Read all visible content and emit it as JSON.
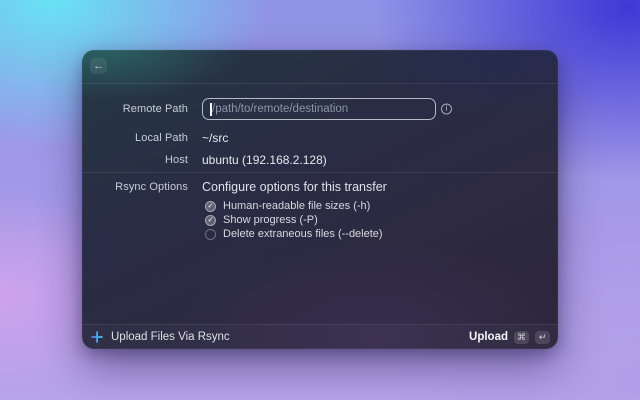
{
  "window": {
    "glyphs": {
      "back": "←",
      "check": "✓",
      "info": "i"
    },
    "fields": {
      "remote": {
        "label": "Remote Path",
        "placeholder": "/path/to/remote/destination",
        "value": ""
      },
      "local": {
        "label": "Local Path",
        "value": "~/src"
      },
      "host": {
        "label": "Host",
        "value": "ubuntu (192.168.2.128)"
      }
    },
    "options": {
      "label": "Rsync Options",
      "description": "Configure options for this transfer",
      "items": [
        {
          "label": "Human-readable file sizes (-h)",
          "checked": true
        },
        {
          "label": "Show progress (-P)",
          "checked": true
        },
        {
          "label": "Delete extraneous files (--delete)",
          "checked": false
        }
      ]
    },
    "footer": {
      "title": "Upload Files Via Rsync",
      "action_label": "Upload",
      "shortcut_keys": {
        "modifier": "⌘",
        "enter": "↵"
      }
    }
  },
  "colors": {
    "icon_gradient_start": "#5a6cf0",
    "icon_gradient_end": "#3ccfee",
    "window_teal": "#2b6264",
    "background_cyan": "#68e3f4",
    "background_indigo": "#4038d6",
    "background_lavender": "#b0a0e8"
  }
}
